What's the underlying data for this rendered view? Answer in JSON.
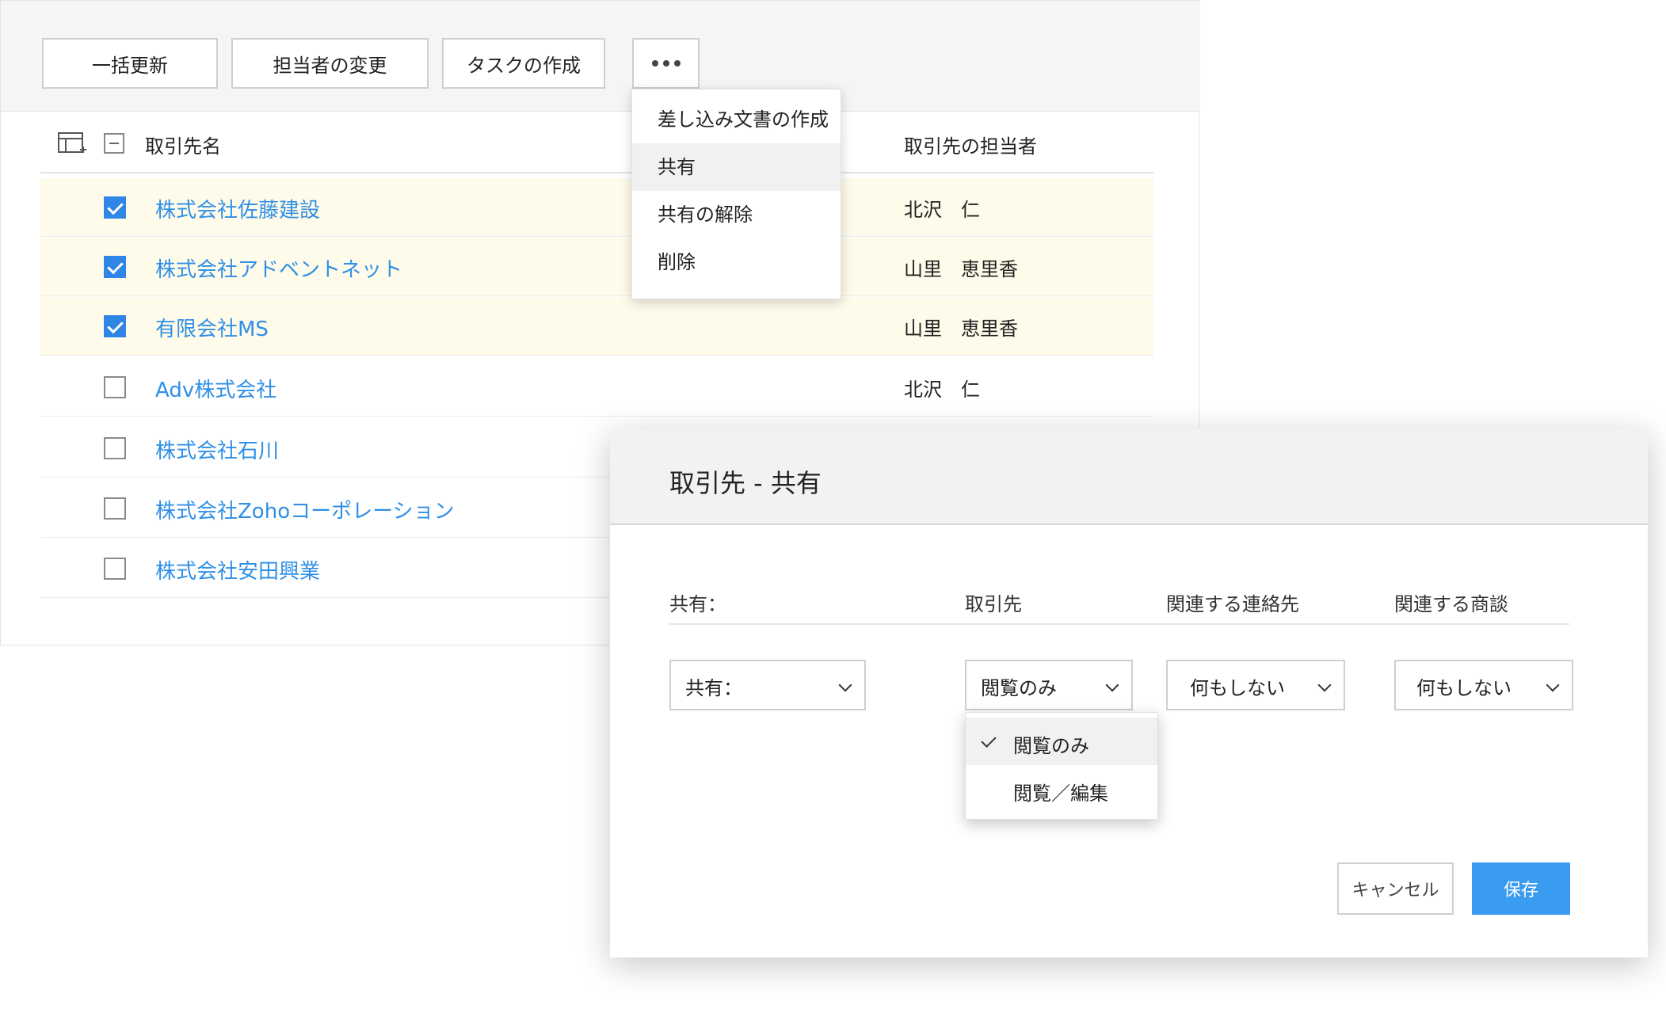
{
  "toolbar": {
    "buttons": [
      "一括更新",
      "担当者の変更",
      "タスクの作成"
    ],
    "more_icon": "more-horizontal-icon"
  },
  "more_menu": {
    "items": [
      "差し込み文書の作成",
      "共有",
      "共有の解除",
      "削除"
    ],
    "active_index": 1
  },
  "table": {
    "headers": {
      "name": "取引先名",
      "owner": "取引先の担当者"
    },
    "rows": [
      {
        "name": "株式会社佐藤建設",
        "owner": "北沢　仁",
        "selected": true
      },
      {
        "name": "株式会社アドベントネット",
        "owner": "山里　恵里香",
        "selected": true
      },
      {
        "name": "有限会社MS",
        "owner": "山里　恵里香",
        "selected": true
      },
      {
        "name": "Adv株式会社",
        "owner": "北沢　仁",
        "selected": false
      },
      {
        "name": "株式会社石川",
        "owner": "",
        "selected": false
      },
      {
        "name": "株式会社Zohoコーポレーション",
        "owner": "",
        "selected": false
      },
      {
        "name": "株式会社安田興業",
        "owner": "",
        "selected": false
      }
    ]
  },
  "modal": {
    "title": "取引先 - 共有",
    "labels": {
      "share": "共有：",
      "account": "取引先",
      "contacts": "関連する連絡先",
      "deals": "関連する商談"
    },
    "selects": {
      "share": "共有：",
      "account": "閲覧のみ",
      "contacts": "何もしない",
      "deals": "何もしない"
    },
    "account_options": [
      "閲覧のみ",
      "閲覧／編集"
    ],
    "cancel": "キャンセル",
    "save": "保存"
  },
  "colors": {
    "link": "#2f8fe6",
    "checkbox": "#2f86e6",
    "selected_row": "#fffbea",
    "primary_button": "#3a9cf0"
  }
}
